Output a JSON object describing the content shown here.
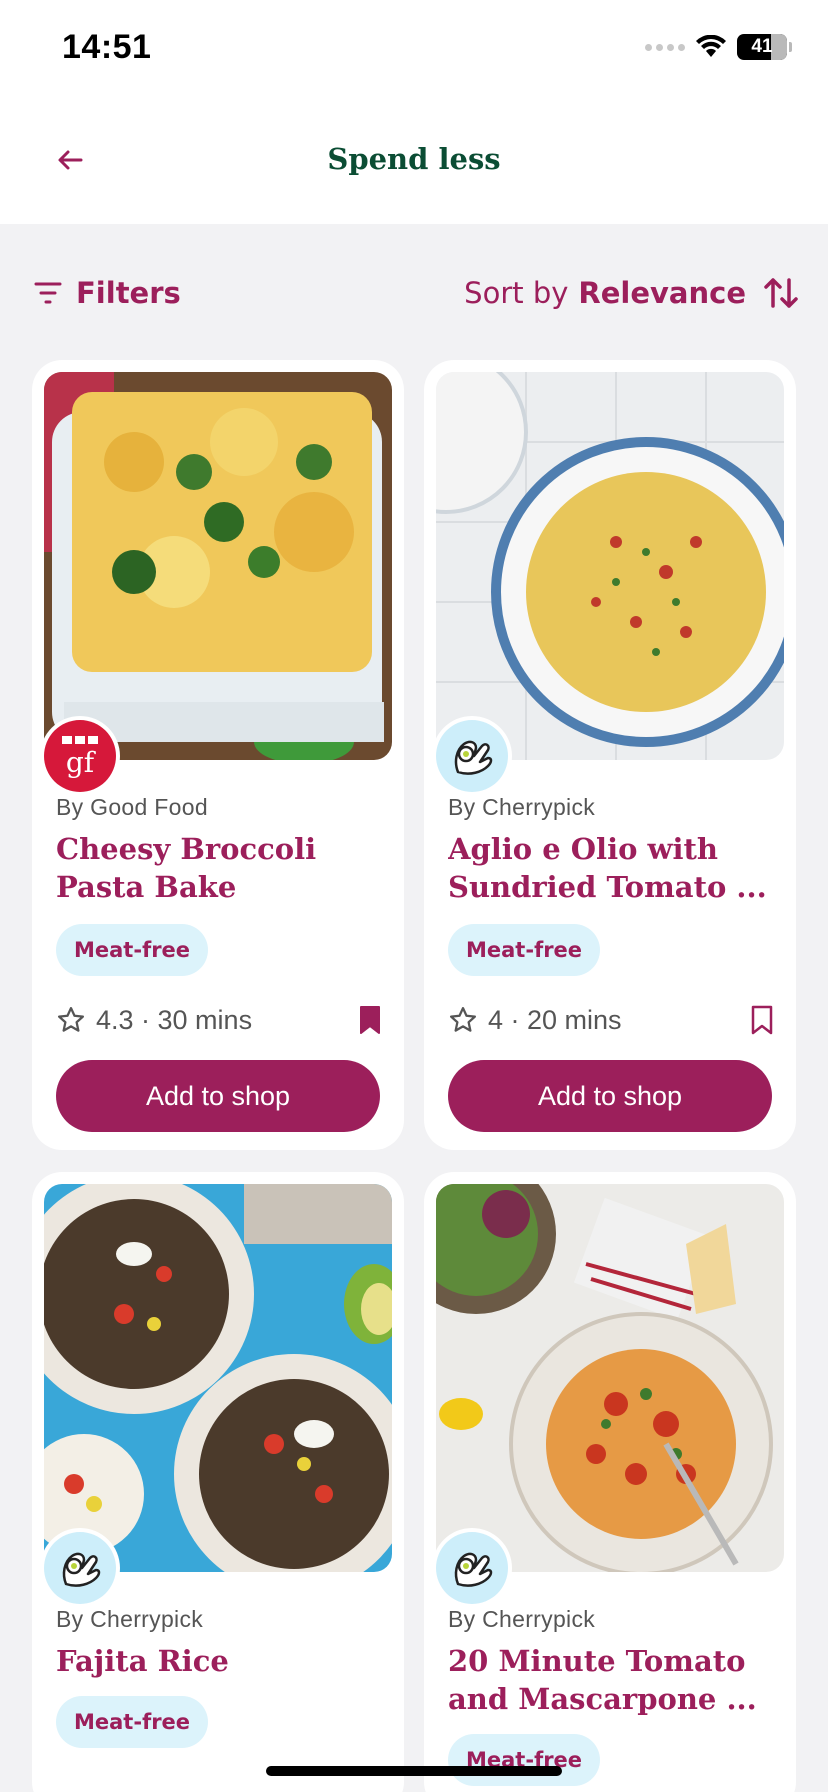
{
  "status_bar": {
    "time": "14:51",
    "battery": "41"
  },
  "header": {
    "title": "Spend less",
    "back_icon": "arrow-left-icon"
  },
  "toolbar": {
    "filters_label": "Filters",
    "sort_prefix": "Sort by",
    "sort_value": "Relevance"
  },
  "colors": {
    "brand": "#9c1f5b",
    "title_green": "#0b4d34",
    "tag_bg": "#dcf3fb",
    "page_bg": "#f2f2f4"
  },
  "recipes": [
    {
      "source": "By Good Food",
      "source_logo": "bbc-good-food-logo",
      "title_line1": "Cheesy Broccoli",
      "title_line2": "Pasta Bake",
      "tag": "Meat-free",
      "meta": "4.3 · 30 mins",
      "saved": true,
      "button": "Add to shop"
    },
    {
      "source": "By Cherrypick",
      "source_logo": "cherrypick-logo",
      "title_line1": "Aglio e Olio with",
      "title_line2": "Sundried Tomato ...",
      "tag": "Meat-free",
      "meta": "4 · 20 mins",
      "saved": false,
      "button": "Add to shop"
    },
    {
      "source": "By Cherrypick",
      "source_logo": "cherrypick-logo",
      "title_line1": "Fajita Rice",
      "title_line2": "",
      "tag": "Meat-free"
    },
    {
      "source": "By Cherrypick",
      "source_logo": "cherrypick-logo",
      "title_line1": "20 Minute Tomato",
      "title_line2": "and Mascarpone ...",
      "tag": "Meat-free"
    }
  ]
}
